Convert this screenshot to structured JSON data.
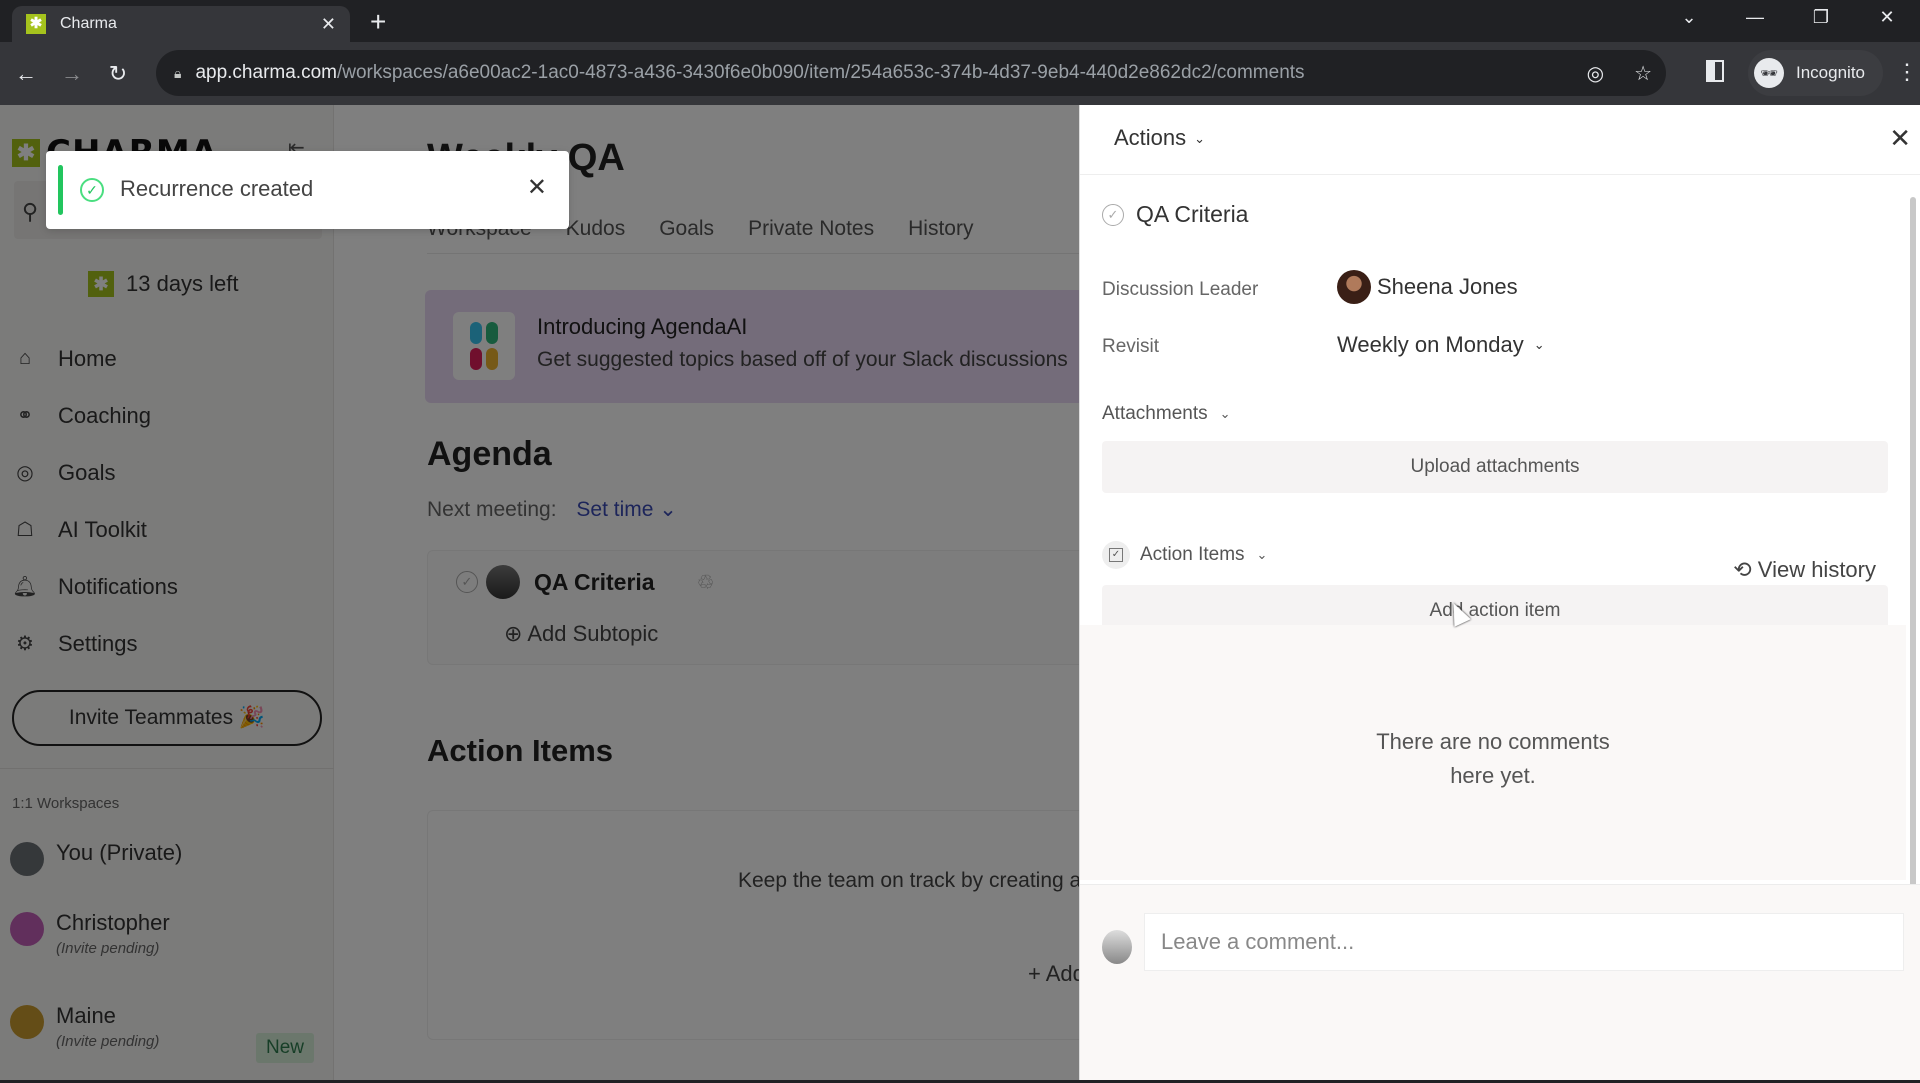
{
  "browser": {
    "tab_title": "Charma",
    "url_host": "app.charma.com",
    "url_path": "/workspaces/a6e00ac2-1ac0-4873-a436-3430f6e0b090/item/254a653c-374b-4d37-9eb4-440d2e862dc2/comments",
    "profile_label": "Incognito"
  },
  "sidebar": {
    "logo_text": "CHARMA",
    "trial_text": "13 days left",
    "nav": [
      {
        "label": "Home",
        "icon": "home-heart-icon"
      },
      {
        "label": "Coaching",
        "icon": "whistle-icon"
      },
      {
        "label": "Goals",
        "icon": "target-icon"
      },
      {
        "label": "AI Toolkit",
        "icon": "robot-icon"
      },
      {
        "label": "Notifications",
        "icon": "bell-icon"
      },
      {
        "label": "Settings",
        "icon": "gear-icon"
      }
    ],
    "invite_label": "Invite Teammates 🎉",
    "workspaces_heading": "1:1 Workspaces",
    "workspaces": [
      {
        "name": "You (Private)",
        "sub": "",
        "badge": "",
        "avatar_color": "#6b7075"
      },
      {
        "name": "Christopher",
        "sub": "(Invite pending)",
        "badge": "",
        "avatar_color": "#c25fb8"
      },
      {
        "name": "Maine",
        "sub": "(Invite pending)",
        "badge": "New",
        "avatar_color": "#c99a2e"
      }
    ]
  },
  "toast": {
    "message": "Recurrence created",
    "accent": "#22c55e"
  },
  "main": {
    "title": "Weekly QA",
    "tabs": [
      "Workspace",
      "Kudos",
      "Goals",
      "Private Notes",
      "History"
    ],
    "banner": {
      "heading": "Introducing AgendaAI",
      "body": "Get suggested topics based off of your Slack discussions"
    },
    "agenda_heading": "Agenda",
    "next_meeting_label": "Next meeting:",
    "next_meeting_value": "Set time",
    "topic": {
      "title": "QA Criteria",
      "add_subtopic": "Add Subtopic"
    },
    "action_items_heading": "Action Items",
    "action_items_empty": "Keep the team on track by creating action items",
    "add_action_item": "+ Add action item"
  },
  "panel": {
    "actions_label": "Actions",
    "item_title": "QA Criteria",
    "discussion_leader_label": "Discussion Leader",
    "discussion_leader": "Sheena Jones",
    "revisit_label": "Revisit",
    "revisit_value": "Weekly on Monday",
    "attachments_label": "Attachments",
    "upload_label": "Upload attachments",
    "action_items_label": "Action Items",
    "add_action_item_label": "Add action item",
    "view_history_label": "View history",
    "no_comments": "There are no comments here yet.",
    "comment_placeholder": "Leave a comment..."
  }
}
